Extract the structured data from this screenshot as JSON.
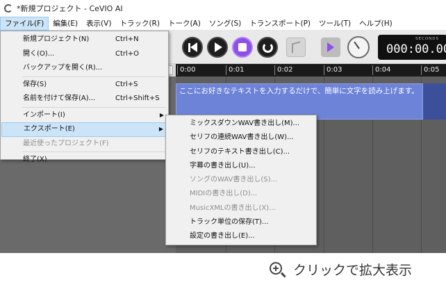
{
  "window": {
    "title": "*新規プロジェクト - CeVIO AI",
    "logo_icon": "cevio-logo-icon"
  },
  "menubar": [
    {
      "label": "ファイル(F)",
      "active": true
    },
    {
      "label": "編集(E)"
    },
    {
      "label": "表示(V)"
    },
    {
      "label": "トラック(R)"
    },
    {
      "label": "トーク(A)"
    },
    {
      "label": "ソング(S)"
    },
    {
      "label": "トランスポート(P)"
    },
    {
      "label": "ツール(T)"
    },
    {
      "label": "ヘルプ(H)"
    }
  ],
  "toolbar": {
    "buttons": [
      "prev-icon",
      "play-icon",
      "stop-icon",
      "loop-icon",
      "flag-icon",
      "arrow-right-icon",
      "dial-icon"
    ],
    "clock": {
      "caption": "SECONDS",
      "time": "000:00.00"
    },
    "accent_color": "#8f4fe8"
  },
  "ruler": {
    "ticks": [
      "0:00",
      "0:01",
      "0:02",
      "0:03",
      "0:04",
      "0:05"
    ]
  },
  "clip": {
    "text": "ここにお好きなテキストを入力するだけで、簡単に文字を読み上げます。",
    "color": "#6d83d8"
  },
  "file_menu": {
    "items": [
      {
        "label": "新規プロジェクト(N)",
        "shortcut": "Ctrl+N"
      },
      {
        "label": "開く(O)...",
        "shortcut": "Ctrl+O"
      },
      {
        "label": "バックアップを開く(R)..."
      },
      {
        "label": "保存(S)",
        "shortcut": "Ctrl+S"
      },
      {
        "label": "名前を付けて保存(A)...",
        "shortcut": "Ctrl+Shift+S"
      },
      {
        "label": "インポート(I)",
        "submenu": "▶"
      },
      {
        "label": "エクスポート(E)",
        "submenu": "▶",
        "highlighted": true
      },
      {
        "label": "最近使ったプロジェクト(F)",
        "disabled": true
      },
      {
        "label": "終了(X)"
      }
    ]
  },
  "export_menu": {
    "items": [
      {
        "label": "ミックスダウンWAV書き出し(M)..."
      },
      {
        "label": "セリフの連続WAV書き出し(W)..."
      },
      {
        "label": "セリフのテキスト書き出し(C)..."
      },
      {
        "label": "字幕の書き出し(U)..."
      },
      {
        "label": "ソングのWAV書き出し(S)...",
        "disabled": true
      },
      {
        "label": "MIDIの書き出し(D)...",
        "disabled": true
      },
      {
        "label": "MusicXMLの書き出し(X)...",
        "disabled": true
      },
      {
        "label": "トラック単位の保存(T)..."
      },
      {
        "label": "設定の書き出し(E)..."
      }
    ]
  },
  "footer": {
    "zoom_text": "クリックで拡大表示",
    "icon": "zoom-in-icon"
  }
}
